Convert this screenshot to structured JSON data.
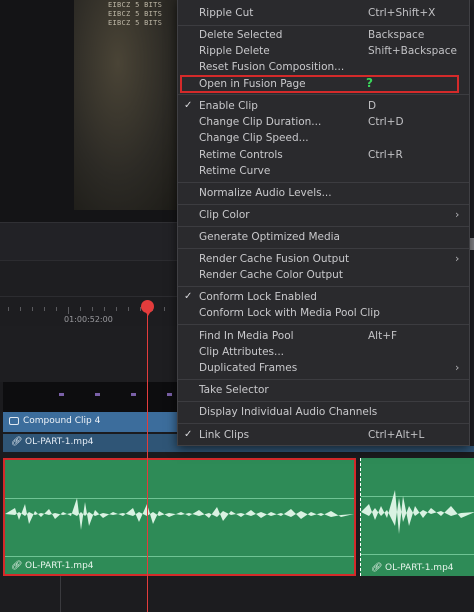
{
  "viewer": {
    "overlay_lines": [
      "EIBCZ   5 BITS",
      "EIBCZ   5 BITS",
      "EIBCZ   5 BITS"
    ]
  },
  "timeline": {
    "ruler_timecode": "01:00:52:00",
    "video_clip_name": "Compound Clip 4",
    "video_link_name": "OL-PART-1.mp4",
    "audio_clip_1_name": "OL-PART-1.mp4",
    "audio_clip_2_name": "OL-PART-1.mp4"
  },
  "menu": {
    "items": [
      {
        "label": "Ripple Cut",
        "shortcut": "Ctrl+Shift+X"
      },
      {
        "label": "Delete Selected",
        "shortcut": "Backspace"
      },
      {
        "label": "Ripple Delete",
        "shortcut": "Shift+Backspace"
      },
      {
        "label": "Reset Fusion Composition...",
        "shortcut": ""
      },
      {
        "label": "Open in Fusion Page",
        "shortcut": ""
      },
      {
        "label": "Enable Clip",
        "shortcut": "D",
        "checked": true
      },
      {
        "label": "Change Clip Duration...",
        "shortcut": "Ctrl+D"
      },
      {
        "label": "Change Clip Speed...",
        "shortcut": ""
      },
      {
        "label": "Retime Controls",
        "shortcut": "Ctrl+R"
      },
      {
        "label": "Retime Curve",
        "shortcut": ""
      },
      {
        "label": "Normalize Audio Levels...",
        "shortcut": ""
      },
      {
        "label": "Clip Color",
        "shortcut": "",
        "submenu": true
      },
      {
        "label": "Generate Optimized Media",
        "shortcut": ""
      },
      {
        "label": "Render Cache Fusion Output",
        "shortcut": "",
        "submenu": true
      },
      {
        "label": "Render Cache Color Output",
        "shortcut": ""
      },
      {
        "label": "Conform Lock Enabled",
        "shortcut": "",
        "checked": true
      },
      {
        "label": "Conform Lock with Media Pool Clip",
        "shortcut": ""
      },
      {
        "label": "Find In Media Pool",
        "shortcut": "Alt+F"
      },
      {
        "label": "Clip Attributes...",
        "shortcut": ""
      },
      {
        "label": "Duplicated Frames",
        "shortcut": "",
        "submenu": true
      },
      {
        "label": "Take Selector",
        "shortcut": ""
      },
      {
        "label": "Display Individual Audio Channels",
        "shortcut": ""
      },
      {
        "label": "Link Clips",
        "shortcut": "Ctrl+Alt+L",
        "checked": true
      }
    ],
    "annotation": "?",
    "check_glyph": "✓",
    "submenu_glyph": "›"
  },
  "colors": {
    "highlight_box": "#d42a2a",
    "annotation": "#39d65a",
    "audio_clip": "#2e8b57",
    "video_label": "#3c6d9c",
    "playhead": "#e33c3c"
  },
  "icons": [
    "link-icon",
    "compound-clip-icon",
    "check-icon",
    "chevron-right-icon"
  ]
}
